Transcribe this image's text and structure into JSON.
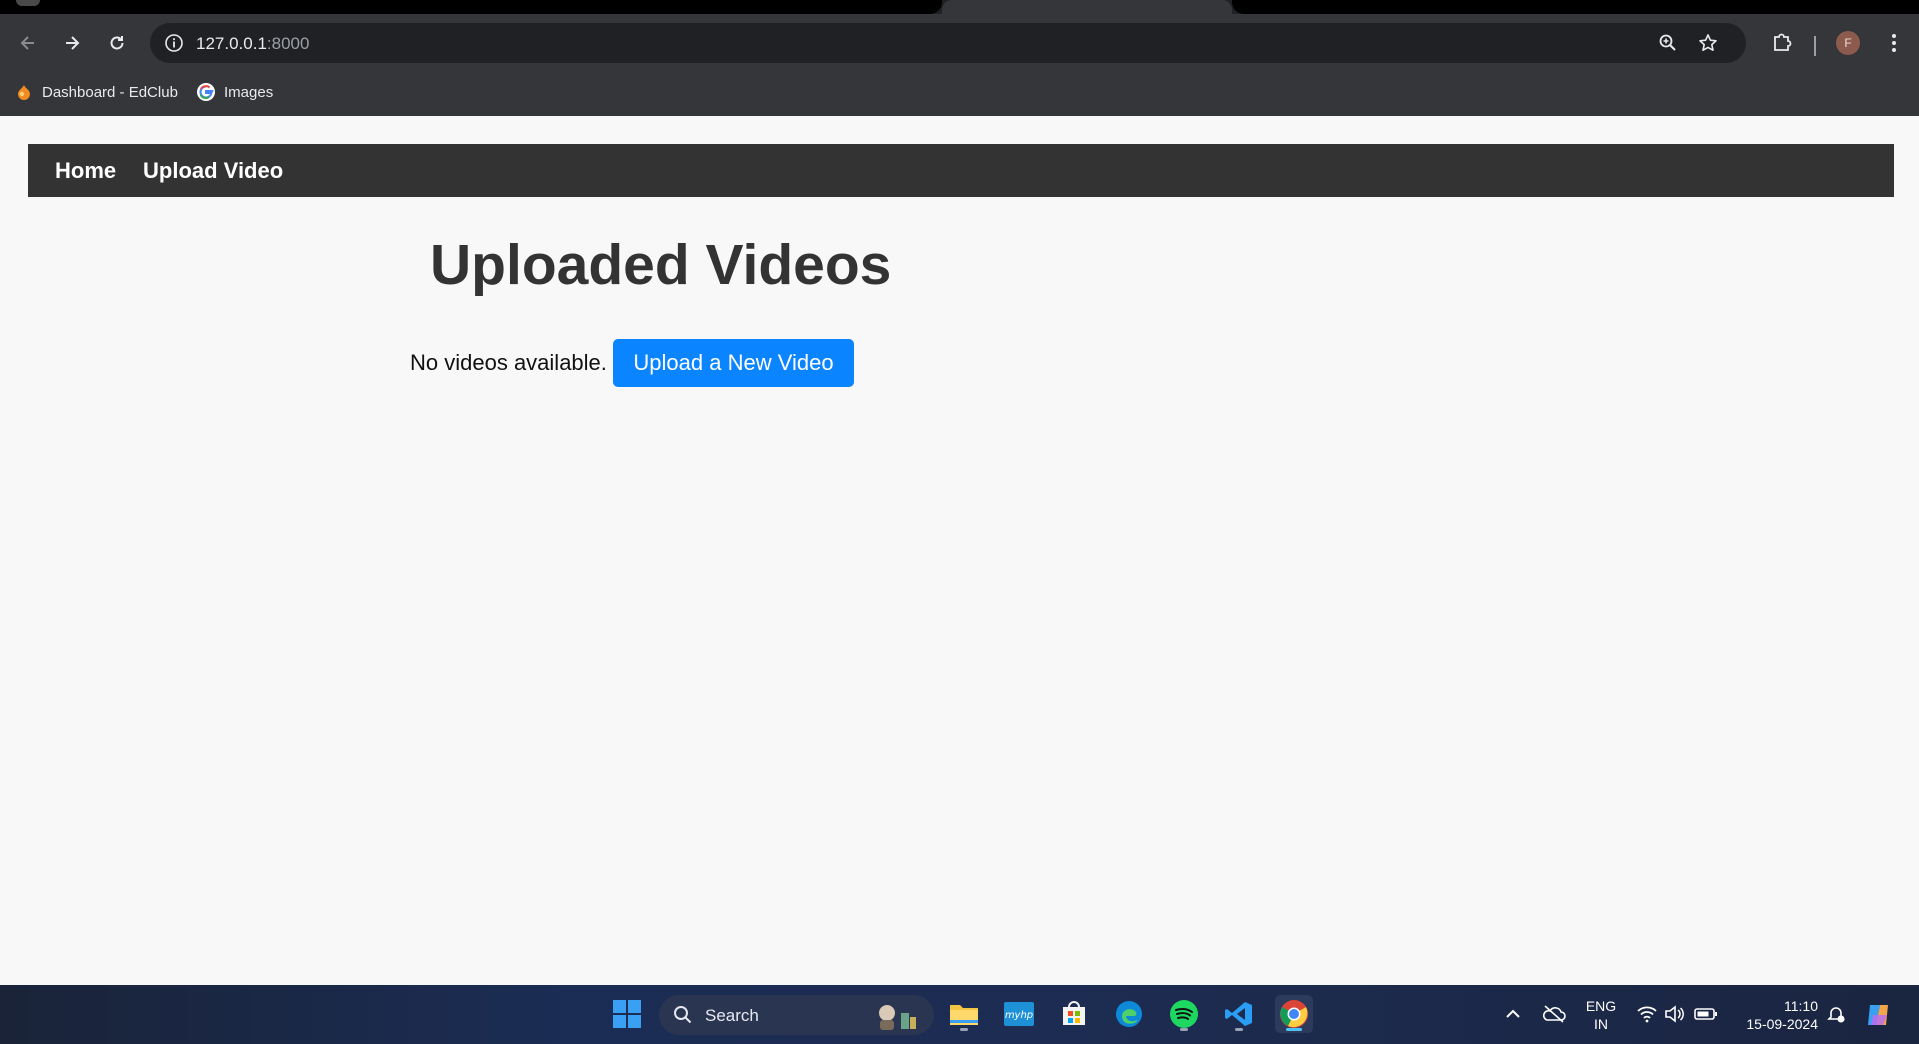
{
  "browser": {
    "url_host": "127.0.0.1",
    "url_port": ":8000",
    "profile_initial": "F",
    "bookmarks": [
      {
        "label": "Dashboard - EdClub",
        "icon": "edclub-icon"
      },
      {
        "label": "Images",
        "icon": "google-icon"
      }
    ]
  },
  "site": {
    "nav": [
      {
        "label": "Home"
      },
      {
        "label": "Upload Video"
      }
    ],
    "title": "Uploaded Videos",
    "empty_message": "No videos available.",
    "upload_button": "Upload a New Video"
  },
  "taskbar": {
    "search_label": "Search",
    "language_line1": "ENG",
    "language_line2": "IN",
    "time": "11:10",
    "date": "15-09-2024",
    "accent": "#4cc2ff"
  },
  "colors": {
    "nav_bg": "#333333",
    "button_bg": "#0a84ff",
    "page_bg": "#f8f8f8"
  }
}
